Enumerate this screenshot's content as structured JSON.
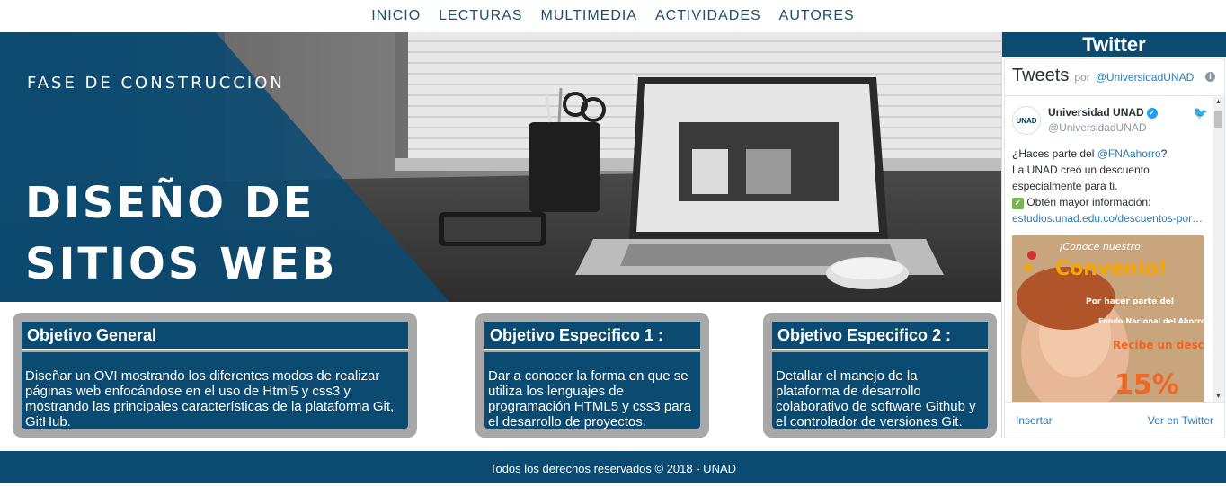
{
  "nav": {
    "items": [
      "INICIO",
      "LECTURAS",
      "MULTIMEDIA",
      "ACTIVIDADES",
      "AUTORES"
    ]
  },
  "hero": {
    "subtitle": "FASE DE CONSTRUCCION",
    "title_line1": "DISEÑO DE",
    "title_line2": "SITIOS WEB",
    "overlay_color": "#0b4a71"
  },
  "twitter": {
    "header": "Twitter",
    "tweets_label": "Tweets",
    "por": "por",
    "handle": "@UniversidadUNAD",
    "user_name": "Universidad UNAD",
    "user_handle": "@UniversidadUNAD",
    "avatar_text": "UNAD",
    "tweet_line1_pre": "¿Haces parte del ",
    "tweet_mention": "@FNAahorro",
    "tweet_line1_post": "?",
    "tweet_line2": "La UNAD creó un descuento especialmente para ti.",
    "tweet_line3": "Obtén mayor información:",
    "tweet_link": "estudios.unad.edu.co/descuentos-por…",
    "media_text1": "¡Conoce nuestro",
    "media_text2": "Convenio!",
    "media_text3": "Por hacer parte del",
    "media_text4": "Fondo Nacional del Ahorro",
    "media_text5": "Recibe un descuento",
    "media_text6": "15%",
    "insertar": "Insertar",
    "ver": "Ver en Twitter"
  },
  "cards": [
    {
      "title": "Objetivo General",
      "text": "Diseñar un OVI mostrando los diferentes modos de realizar páginas web enfocándose en el uso de Html5 y css3 y mostrando las principales características de la plataforma Git, GitHub."
    },
    {
      "title": "Objetivo Especifico 1 :",
      "text": "Dar a conocer la forma en que se utiliza los lenguajes de programación HTML5 y css3 para el desarrollo de proyectos."
    },
    {
      "title": "Objetivo Especifico 2 :",
      "text": "Detallar el manejo de la plataforma de desarrollo colaborativo de software Github y el controlador de versiones Git."
    }
  ],
  "footer": {
    "text": "Todos los derechos reservados © 2018 - UNAD"
  },
  "colors": {
    "primary": "#0b4a71",
    "card_frame": "#a8a8a8",
    "nav_text": "#1d4f6e"
  }
}
